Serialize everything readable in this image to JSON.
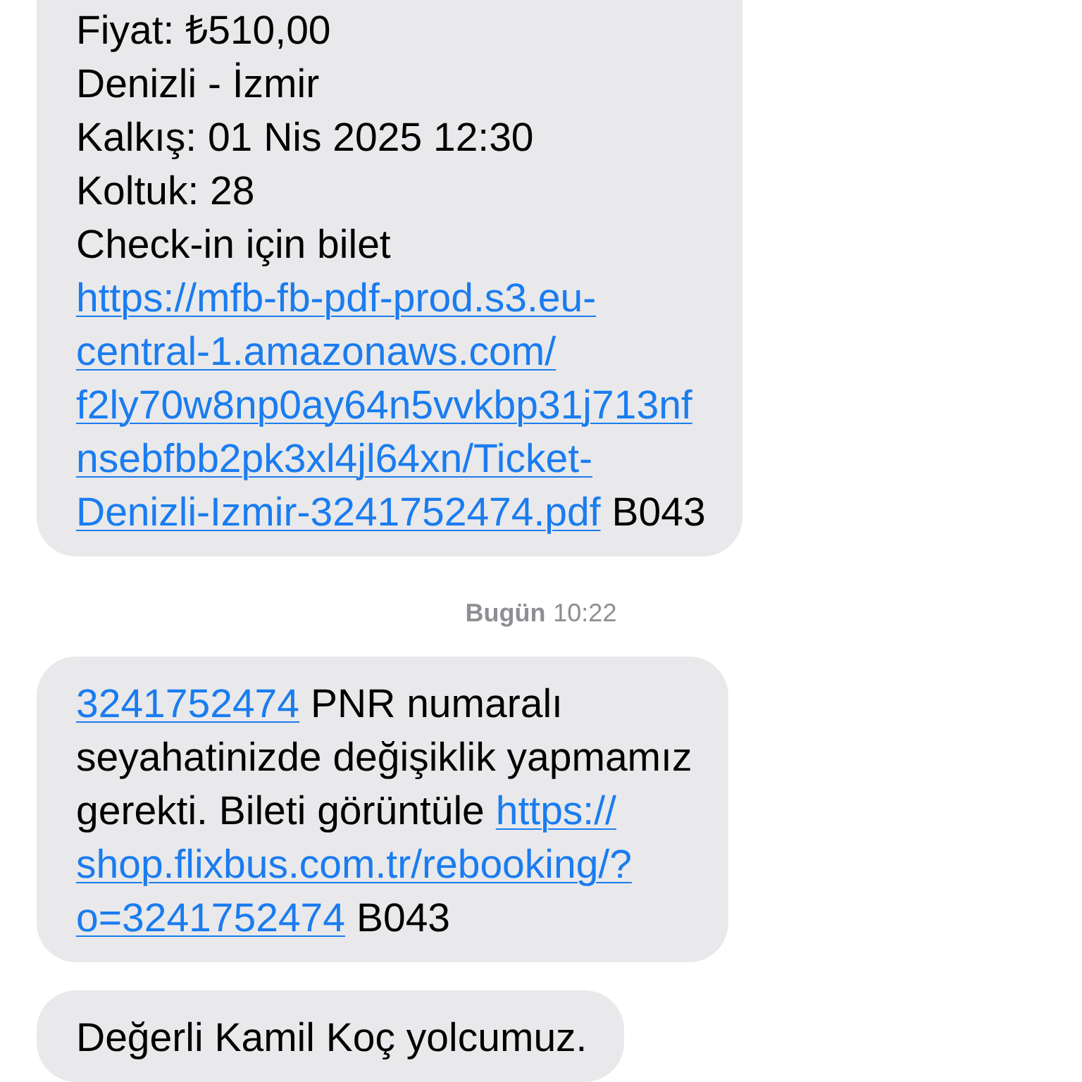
{
  "messages": [
    {
      "kind": "bubble",
      "lines": [
        [
          {
            "kind": "text",
            "text": "Fiyat: ₺510,00"
          }
        ],
        [
          {
            "kind": "text",
            "text": "Denizli - İzmir"
          }
        ],
        [
          {
            "kind": "text",
            "text": "Kalkış: 01 Nis 2025 12:30"
          }
        ],
        [
          {
            "kind": "text",
            "text": "Koltuk: 28"
          }
        ],
        [
          {
            "kind": "text",
            "text": "Check-in için bilet"
          }
        ],
        [
          {
            "kind": "link",
            "text": "https://mfb-fb-pdf-prod.s3.eu-"
          }
        ],
        [
          {
            "kind": "link",
            "text": "central-1.amazonaws.com/"
          }
        ],
        [
          {
            "kind": "link",
            "text": "f2ly70w8np0ay64n5vvkbp31j713nf"
          }
        ],
        [
          {
            "kind": "link",
            "text": "nsebfbb2pk3xl4jl64xn/Ticket-"
          }
        ],
        [
          {
            "kind": "link",
            "text": "Denizli-Izmir-3241752474.pdf"
          },
          {
            "kind": "text",
            "text": "B043"
          }
        ]
      ]
    },
    {
      "kind": "timestamp",
      "day": "Bugün",
      "time": "10:22"
    },
    {
      "kind": "bubble",
      "lines": [
        [
          {
            "kind": "link",
            "text": "3241752474"
          },
          {
            "kind": "text",
            "text": "PNR numaralı"
          }
        ],
        [
          {
            "kind": "text",
            "text": "seyahatinizde değişiklik yapmamız"
          }
        ],
        [
          {
            "kind": "text",
            "text": "gerekti. Bileti görüntüle"
          },
          {
            "kind": "link",
            "text": "https://"
          }
        ],
        [
          {
            "kind": "link",
            "text": "shop.flixbus.com.tr/rebooking/?"
          }
        ],
        [
          {
            "kind": "link",
            "text": "o=3241752474"
          },
          {
            "kind": "text",
            "text": "B043"
          }
        ]
      ]
    },
    {
      "kind": "bubble",
      "lines": [
        [
          {
            "kind": "text",
            "text": "Değerli Kamil Koç yolcumuz."
          }
        ]
      ]
    }
  ]
}
